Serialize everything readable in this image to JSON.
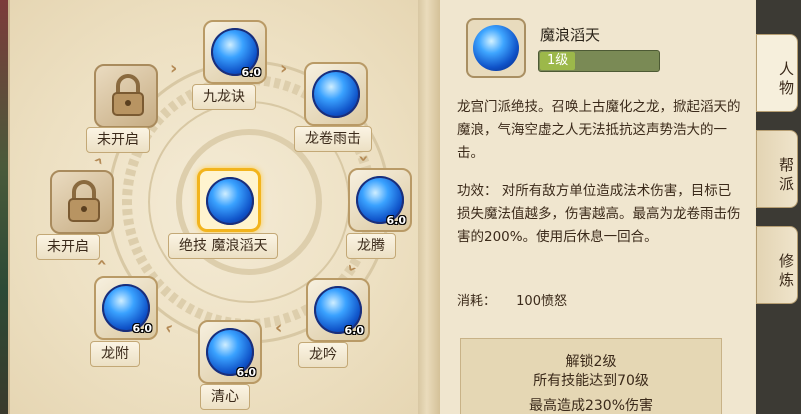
{
  "skill_tree": {
    "nodes": [
      {
        "label": "九龙诀",
        "level": "6.0"
      },
      {
        "label": "龙卷雨击",
        "level": ""
      },
      {
        "label": "龙腾",
        "level": "6.0"
      },
      {
        "label": "龙吟",
        "level": "6.0"
      },
      {
        "label": "清心",
        "level": "6.0"
      },
      {
        "label": "龙附",
        "level": "6.0"
      },
      {
        "label": "未开启",
        "level": ""
      },
      {
        "label": "未开启",
        "level": ""
      },
      {
        "label": "绝技  魔浪滔天",
        "level": ""
      }
    ],
    "selected_label": "绝技  魔浪滔天"
  },
  "detail": {
    "skill_name": "魔浪滔天",
    "level_text": "1级",
    "level_progress": 0.3,
    "description": "龙宫门派绝技。召唤上古魔化之龙，掀起滔天的魔浪，气海空虚之人无法抵抗这声势浩大的一击。",
    "effect_label": "功效：",
    "effect_text": "对所有敌方单位造成法术伤害，目标已损失魔法值越多，伤害越高。最高为龙卷雨击伤害的200%。使用后休息一回合。",
    "cost_label": "消耗：",
    "cost_value": "100愤怒",
    "unlock_line1": "解锁2级",
    "unlock_line2": "所有技能达到70级",
    "unlock_line3": "最高造成230%伤害"
  },
  "tabs": [
    {
      "label": "人物"
    },
    {
      "label": "帮派"
    },
    {
      "label": "修炼"
    }
  ],
  "colors": {
    "accent_gold": "#f2b41d",
    "level_green": "#9cb84a",
    "orb_blue": "#0f52c8"
  }
}
